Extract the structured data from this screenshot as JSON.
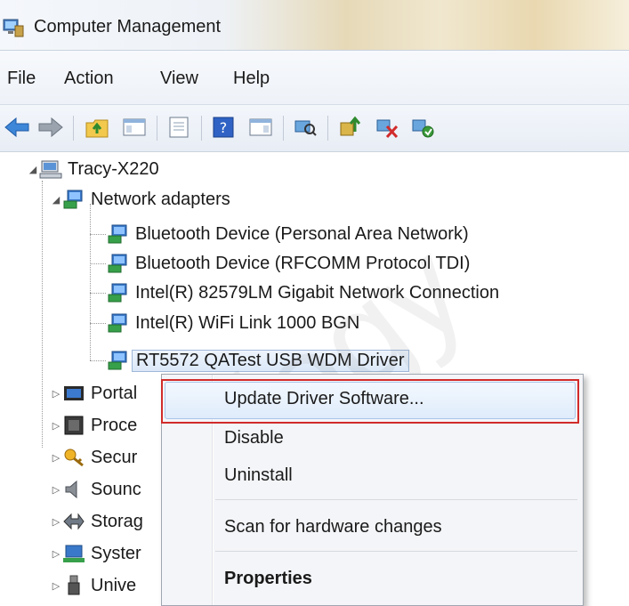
{
  "window": {
    "title": "Computer Management"
  },
  "menu": [
    "File",
    "Action",
    "View",
    "Help"
  ],
  "toolbar": {
    "buttons": [
      "back-arrow-icon",
      "forward-arrow-icon",
      "up-folder-icon",
      "show-hide-console-tree-icon",
      "export-list-icon",
      "help-icon",
      "action-pane-icon",
      "scan-hardware-icon",
      "update-driver-icon",
      "uninstall-icon",
      "enable-device-icon"
    ]
  },
  "tree": {
    "root": "Tracy-X220",
    "category": "Network adapters",
    "adapters": [
      "Bluetooth Device (Personal Area Network)",
      "Bluetooth Device (RFCOMM Protocol TDI)",
      "Intel(R) 82579LM Gigabit Network Connection",
      "Intel(R) WiFi Link 1000 BGN",
      "RT5572 QATest USB WDM Driver"
    ],
    "other_categories": [
      "Portal",
      "Proce",
      "Secur",
      "Sounc",
      "Storag",
      "Syster",
      "Unive"
    ]
  },
  "context_menu": {
    "items": [
      "Update Driver Software...",
      "Disable",
      "Uninstall",
      "Scan for hardware changes",
      "Properties"
    ],
    "highlighted_index": 0
  },
  "colors": {
    "highlight_box": "#d12b2b",
    "selection": "#dbe8f8"
  }
}
